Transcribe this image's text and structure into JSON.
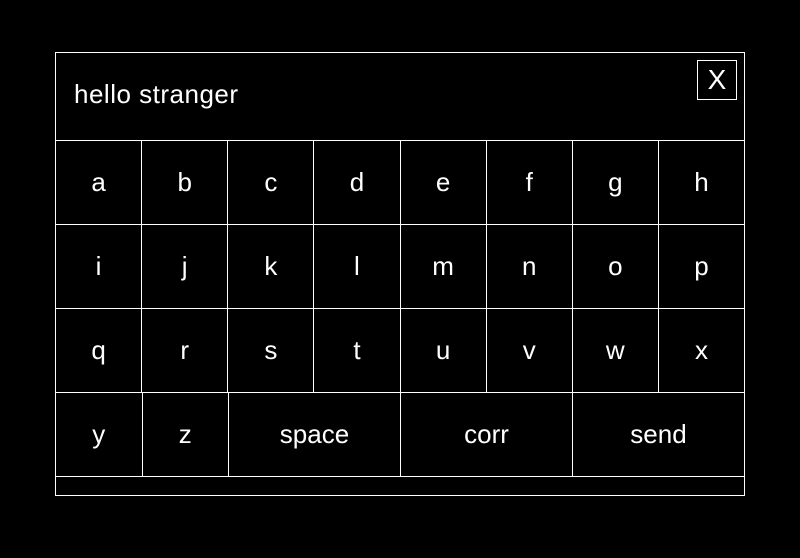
{
  "display": {
    "text": "hello stranger",
    "close_label": "X"
  },
  "rows": [
    [
      {
        "label": "a",
        "wide": false
      },
      {
        "label": "b",
        "wide": false
      },
      {
        "label": "c",
        "wide": false
      },
      {
        "label": "d",
        "wide": false
      },
      {
        "label": "e",
        "wide": false
      },
      {
        "label": "f",
        "wide": false
      },
      {
        "label": "g",
        "wide": false
      },
      {
        "label": "h",
        "wide": false
      }
    ],
    [
      {
        "label": "i",
        "wide": false
      },
      {
        "label": "j",
        "wide": false
      },
      {
        "label": "k",
        "wide": false
      },
      {
        "label": "l",
        "wide": false
      },
      {
        "label": "m",
        "wide": false
      },
      {
        "label": "n",
        "wide": false
      },
      {
        "label": "o",
        "wide": false
      },
      {
        "label": "p",
        "wide": false
      }
    ],
    [
      {
        "label": "q",
        "wide": false
      },
      {
        "label": "r",
        "wide": false
      },
      {
        "label": "s",
        "wide": false
      },
      {
        "label": "t",
        "wide": false
      },
      {
        "label": "u",
        "wide": false
      },
      {
        "label": "v",
        "wide": false
      },
      {
        "label": "w",
        "wide": false
      },
      {
        "label": "x",
        "wide": false
      }
    ],
    [
      {
        "label": "y",
        "wide": false
      },
      {
        "label": "z",
        "wide": false
      },
      {
        "label": "space",
        "wide": true
      },
      {
        "label": "corr",
        "wide": true
      },
      {
        "label": "send",
        "wide": true
      }
    ]
  ]
}
